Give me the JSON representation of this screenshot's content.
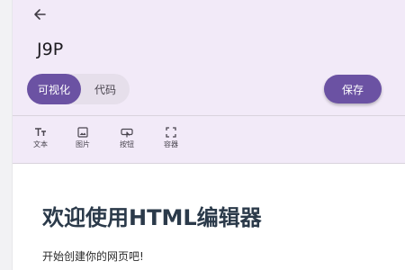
{
  "header": {
    "back_icon": "arrow-left-icon",
    "title": "J9P"
  },
  "mode_toggle": {
    "options": [
      {
        "label": "可视化",
        "selected": true
      },
      {
        "label": "代码",
        "selected": false
      }
    ]
  },
  "save_button": {
    "label": "保存"
  },
  "toolbar": {
    "tools": [
      {
        "label": "文本",
        "icon": "text-icon"
      },
      {
        "label": "图片",
        "icon": "image-icon"
      },
      {
        "label": "按钮",
        "icon": "button-icon"
      },
      {
        "label": "容器",
        "icon": "container-icon"
      }
    ]
  },
  "content": {
    "heading": "欢迎使用HTML编辑器",
    "paragraph": "开始创建你的网页吧!"
  },
  "colors": {
    "header_bg": "#f2eaf8",
    "accent": "#6b52a3",
    "toggle_bg": "#e6dfeb",
    "heading_text": "#2b3a4a"
  }
}
